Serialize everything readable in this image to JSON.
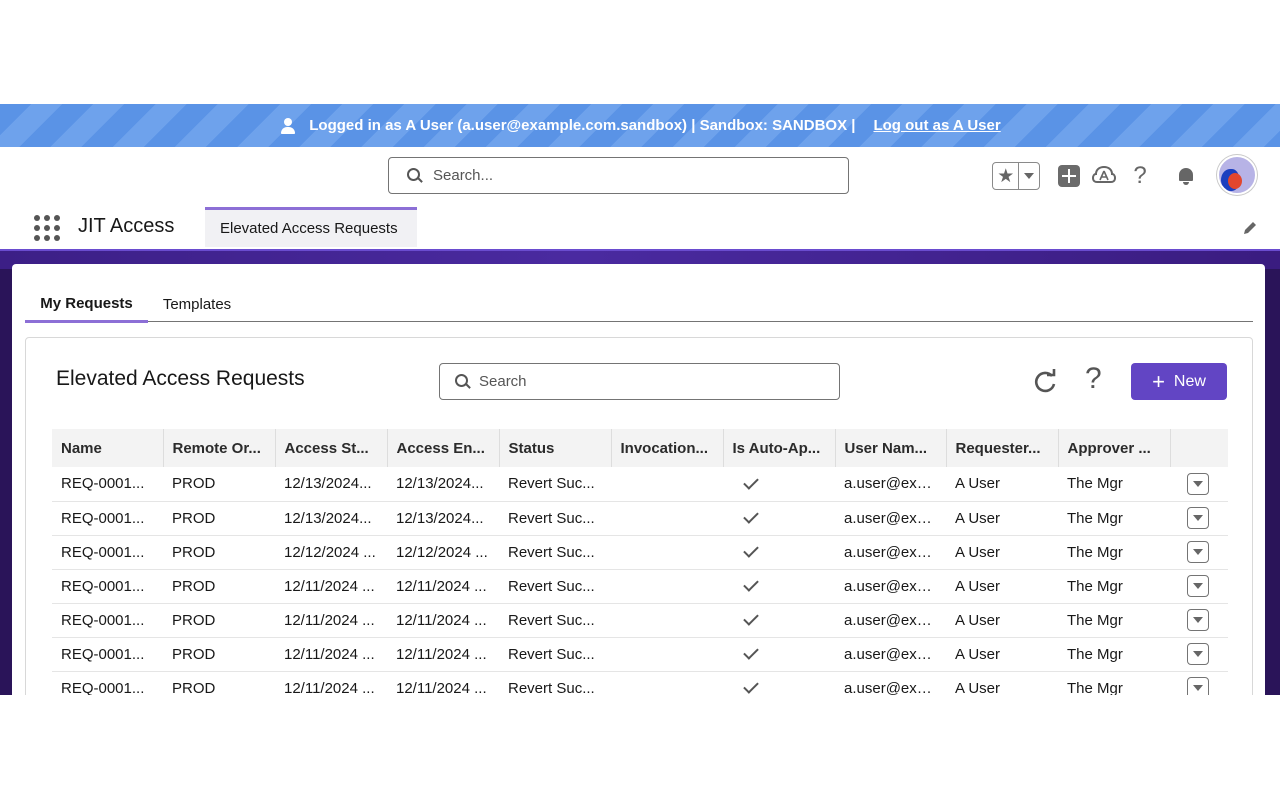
{
  "banner": {
    "text": "Logged in as A User (a.user@example.com.sandbox) | Sandbox: SANDBOX |",
    "logout_label": "Log out as A User"
  },
  "header": {
    "search_placeholder": "Search...",
    "icons": [
      "favorites-star-icon",
      "favorites-menu-icon",
      "global-actions-icon",
      "trailhead-icon",
      "help-icon",
      "notifications-bell-icon",
      "user-avatar"
    ]
  },
  "app_nav": {
    "app_name": "JIT Access",
    "tab_label": "Elevated Access Requests"
  },
  "tabs": [
    {
      "label": "My Requests",
      "active": true
    },
    {
      "label": "Templates",
      "active": false
    }
  ],
  "list": {
    "title": "Elevated Access Requests",
    "search_placeholder": "Search",
    "new_label": "New",
    "columns": [
      "Name",
      "Remote Or...",
      "Access St...",
      "Access En...",
      "Status",
      "Invocation...",
      "Is Auto-Ap...",
      "User Nam...",
      "Requester...",
      "Approver ..."
    ],
    "rows": [
      {
        "name": "REQ-0001...",
        "remote_org": "PROD",
        "access_start": "12/13/2024...",
        "access_end": "12/13/2024...",
        "status": "Revert Suc...",
        "invocation": "",
        "auto_approved": true,
        "user_name": "a.user@exa...",
        "requester": "A User",
        "approver": "The Mgr"
      },
      {
        "name": "REQ-0001...",
        "remote_org": "PROD",
        "access_start": "12/13/2024...",
        "access_end": "12/13/2024...",
        "status": "Revert Suc...",
        "invocation": "",
        "auto_approved": true,
        "user_name": "a.user@exa...",
        "requester": "A User",
        "approver": "The Mgr"
      },
      {
        "name": "REQ-0001...",
        "remote_org": "PROD",
        "access_start": "12/12/2024 ...",
        "access_end": "12/12/2024 ...",
        "status": "Revert Suc...",
        "invocation": "",
        "auto_approved": true,
        "user_name": "a.user@exa...",
        "requester": "A User",
        "approver": "The Mgr"
      },
      {
        "name": "REQ-0001...",
        "remote_org": "PROD",
        "access_start": "12/11/2024 ...",
        "access_end": "12/11/2024 ...",
        "status": "Revert Suc...",
        "invocation": "",
        "auto_approved": true,
        "user_name": "a.user@exa...",
        "requester": "A User",
        "approver": "The Mgr"
      },
      {
        "name": "REQ-0001...",
        "remote_org": "PROD",
        "access_start": "12/11/2024 ...",
        "access_end": "12/11/2024 ...",
        "status": "Revert Suc...",
        "invocation": "",
        "auto_approved": true,
        "user_name": "a.user@exa...",
        "requester": "A User",
        "approver": "The Mgr"
      },
      {
        "name": "REQ-0001...",
        "remote_org": "PROD",
        "access_start": "12/11/2024 ...",
        "access_end": "12/11/2024 ...",
        "status": "Revert Suc...",
        "invocation": "",
        "auto_approved": true,
        "user_name": "a.user@exa...",
        "requester": "A User",
        "approver": "The Mgr"
      },
      {
        "name": "REQ-0001...",
        "remote_org": "PROD",
        "access_start": "12/11/2024 ...",
        "access_end": "12/11/2024 ...",
        "status": "Revert Suc...",
        "invocation": "",
        "auto_approved": true,
        "user_name": "a.user@exa...",
        "requester": "A User",
        "approver": "The Mgr"
      }
    ]
  },
  "colors": {
    "banner": "#5a93e6",
    "accent": "#6245c4",
    "tab_indicator": "#8c6fd6",
    "band": "#2a1459"
  }
}
